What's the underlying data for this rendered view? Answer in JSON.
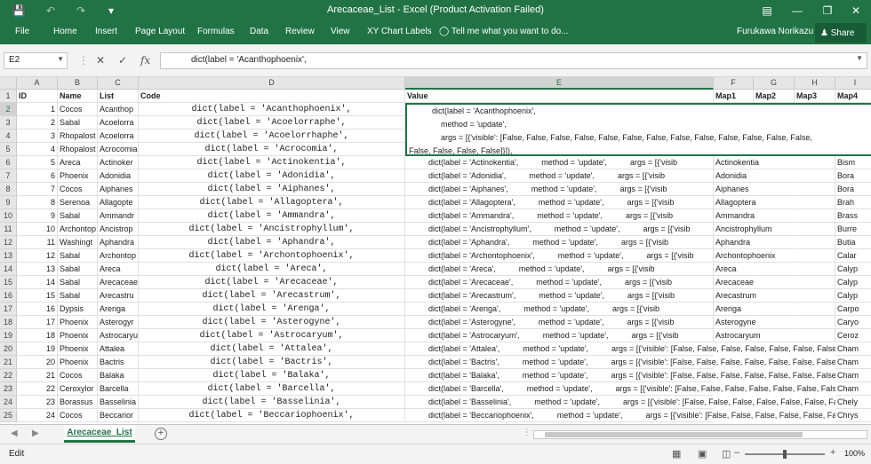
{
  "titlebar": {
    "title": "Arecaceae_List - Excel (Product Activation Failed)",
    "save_icon": "save-icon",
    "undo_icon": "undo-icon",
    "redo_icon": "redo-icon",
    "customize_icon": "customize-qa-icon"
  },
  "ribbon": {
    "tabs": [
      "File",
      "Home",
      "Insert",
      "Page Layout",
      "Formulas",
      "Data",
      "Review",
      "View",
      "XY Chart Labels",
      "Tell me what you want to do..."
    ],
    "user": "Furukawa Norikazu",
    "share": "Share"
  },
  "formula_bar": {
    "name_box": "E2",
    "formula": "dict(label = 'Acanthophoenix',"
  },
  "columns": [
    "A",
    "B",
    "C",
    "D",
    "E",
    "F",
    "G",
    "H",
    "I"
  ],
  "header_row": {
    "id": "ID",
    "name": "Name",
    "list": "List",
    "code": "Code",
    "value": "Value",
    "map1": "Map1",
    "map2": "Map2",
    "map3": "Map3",
    "map4": "Map4"
  },
  "edit_cell_lines": [
    "dict(label = 'Acanthophoenix',",
    "method = 'update',",
    "args = [{'visible': [False, False, False, False, False, False, False, False, False, False, False, False, False,",
    "False, False, False, False]}]),"
  ],
  "rows": [
    {
      "n": 2,
      "id": "1",
      "name": "Cocos",
      "list": "Acanthop",
      "code": "dict(label = 'Acanthophoenix',",
      "label": "Acanthophoenix",
      "f": "",
      "i": ""
    },
    {
      "n": 3,
      "id": "2",
      "name": "Sabal",
      "list": "Acoelorra",
      "code": "dict(label = 'Acoelorraphe',",
      "label": "Acoelorraphe",
      "f": "",
      "i": ""
    },
    {
      "n": 4,
      "id": "3",
      "name": "Rhopalost",
      "list": "Acoelorra",
      "code": "dict(label = 'Acoelorrhaphe',",
      "label": "Acoelorrhaphe",
      "f": "",
      "i": ""
    },
    {
      "n": 5,
      "id": "4",
      "name": "Rhopalost",
      "list": "Acrocomia",
      "code": "dict(label = 'Acrocomia',",
      "label": "Acrocomia",
      "f": "",
      "i": ""
    },
    {
      "n": 6,
      "id": "5",
      "name": "Areca",
      "list": "Actinoker",
      "code": "dict(label = 'Actinokentia',",
      "label": "Actinokentia",
      "f": "Actinokentia",
      "i": "Bism"
    },
    {
      "n": 7,
      "id": "6",
      "name": "Phoenix",
      "list": "Adonidia",
      "code": "dict(label = 'Adonidia',",
      "label": "Adonidia",
      "f": "Adonidia",
      "i": "Bora"
    },
    {
      "n": 8,
      "id": "7",
      "name": "Cocos",
      "list": "Aiphanes",
      "code": "dict(label = 'Aiphanes',",
      "label": "Aiphanes",
      "f": "Aiphanes",
      "i": "Bora"
    },
    {
      "n": 9,
      "id": "8",
      "name": "Serenoa",
      "list": "Allagopte",
      "code": "dict(label = 'Allagoptera',",
      "label": "Allagoptera",
      "f": "Allagoptera",
      "i": "Brah"
    },
    {
      "n": 10,
      "id": "9",
      "name": "Sabal",
      "list": "Ammandr",
      "code": "dict(label = 'Ammandra',",
      "label": "Ammandra",
      "f": "Ammandra",
      "i": "Brass"
    },
    {
      "n": 11,
      "id": "10",
      "name": "Archontop",
      "list": "Ancistrop",
      "code": "dict(label = 'Ancistrophyllum',",
      "label": "Ancistrophyllum",
      "f": "Ancistrophyllum",
      "i": "Burre"
    },
    {
      "n": 12,
      "id": "11",
      "name": "Washingt",
      "list": "Aphandra",
      "code": "dict(label = 'Aphandra',",
      "label": "Aphandra",
      "f": "Aphandra",
      "i": "Butia"
    },
    {
      "n": 13,
      "id": "12",
      "name": "Sabal",
      "list": "Archontop",
      "code": "dict(label = 'Archontophoenix',",
      "label": "Archontophoenix",
      "f": "Archontophoenix",
      "i": "Calar"
    },
    {
      "n": 14,
      "id": "13",
      "name": "Sabal",
      "list": "Areca",
      "code": "dict(label = 'Areca',",
      "label": "Areca",
      "f": "Areca",
      "i": "Calyp"
    },
    {
      "n": 15,
      "id": "14",
      "name": "Sabal",
      "list": "Arecaceae",
      "code": "dict(label = 'Arecaceae',",
      "label": "Arecaceae",
      "f": "Arecaceae",
      "i": "Calyp"
    },
    {
      "n": 16,
      "id": "15",
      "name": "Sabal",
      "list": "Arecastru",
      "code": "dict(label = 'Arecastrum',",
      "label": "Arecastrum",
      "f": "Arecastrum",
      "i": "Calyp"
    },
    {
      "n": 17,
      "id": "16",
      "name": "Dypsis",
      "list": "Arenga",
      "code": "dict(label = 'Arenga',",
      "label": "Arenga",
      "f": "Arenga",
      "i": "Carpo"
    },
    {
      "n": 18,
      "id": "17",
      "name": "Phoenix",
      "list": "Asterogyr",
      "code": "dict(label = 'Asterogyne',",
      "label": "Asterogyne",
      "f": "Asterogyne",
      "i": "Caryo"
    },
    {
      "n": 19,
      "id": "18",
      "name": "Phoenix",
      "list": "Astrocaryu",
      "code": "dict(label = 'Astrocaryum',",
      "label": "Astrocaryum",
      "f": "Astrocaryum",
      "i": "Ceroz"
    },
    {
      "n": 20,
      "id": "19",
      "name": "Phoenix",
      "list": "Attalea",
      "code": "dict(label = 'Attalea',",
      "label": "Attalea",
      "f": "",
      "i": "Cham"
    },
    {
      "n": 21,
      "id": "20",
      "name": "Phoenix",
      "list": "Bactris",
      "code": "dict(label = 'Bactris',",
      "label": "Bactris",
      "f": "",
      "i": "Cham"
    },
    {
      "n": 22,
      "id": "21",
      "name": "Cocos",
      "list": "Balaka",
      "code": "dict(label = 'Balaka',",
      "label": "Balaka",
      "f": "",
      "i": "Cham"
    },
    {
      "n": 23,
      "id": "22",
      "name": "Ceroxylor",
      "list": "Barcella",
      "code": "dict(label = 'Barcella',",
      "label": "Barcella",
      "f": "",
      "i": "Cham"
    },
    {
      "n": 24,
      "id": "23",
      "name": "Borassus",
      "list": "Basselinia",
      "code": "dict(label = 'Basselinia',",
      "label": "Basselinia",
      "f": "",
      "i": "Chely"
    },
    {
      "n": 25,
      "id": "24",
      "name": "Cocos",
      "list": "Beccarior",
      "code": "dict(label = 'Beccariophoenix',",
      "label": "Beccariophoenix",
      "f": "",
      "i": "Chrys"
    }
  ],
  "sheet_tab": "Arecaceae_List",
  "status": {
    "mode": "Edit",
    "zoom": "100%"
  }
}
